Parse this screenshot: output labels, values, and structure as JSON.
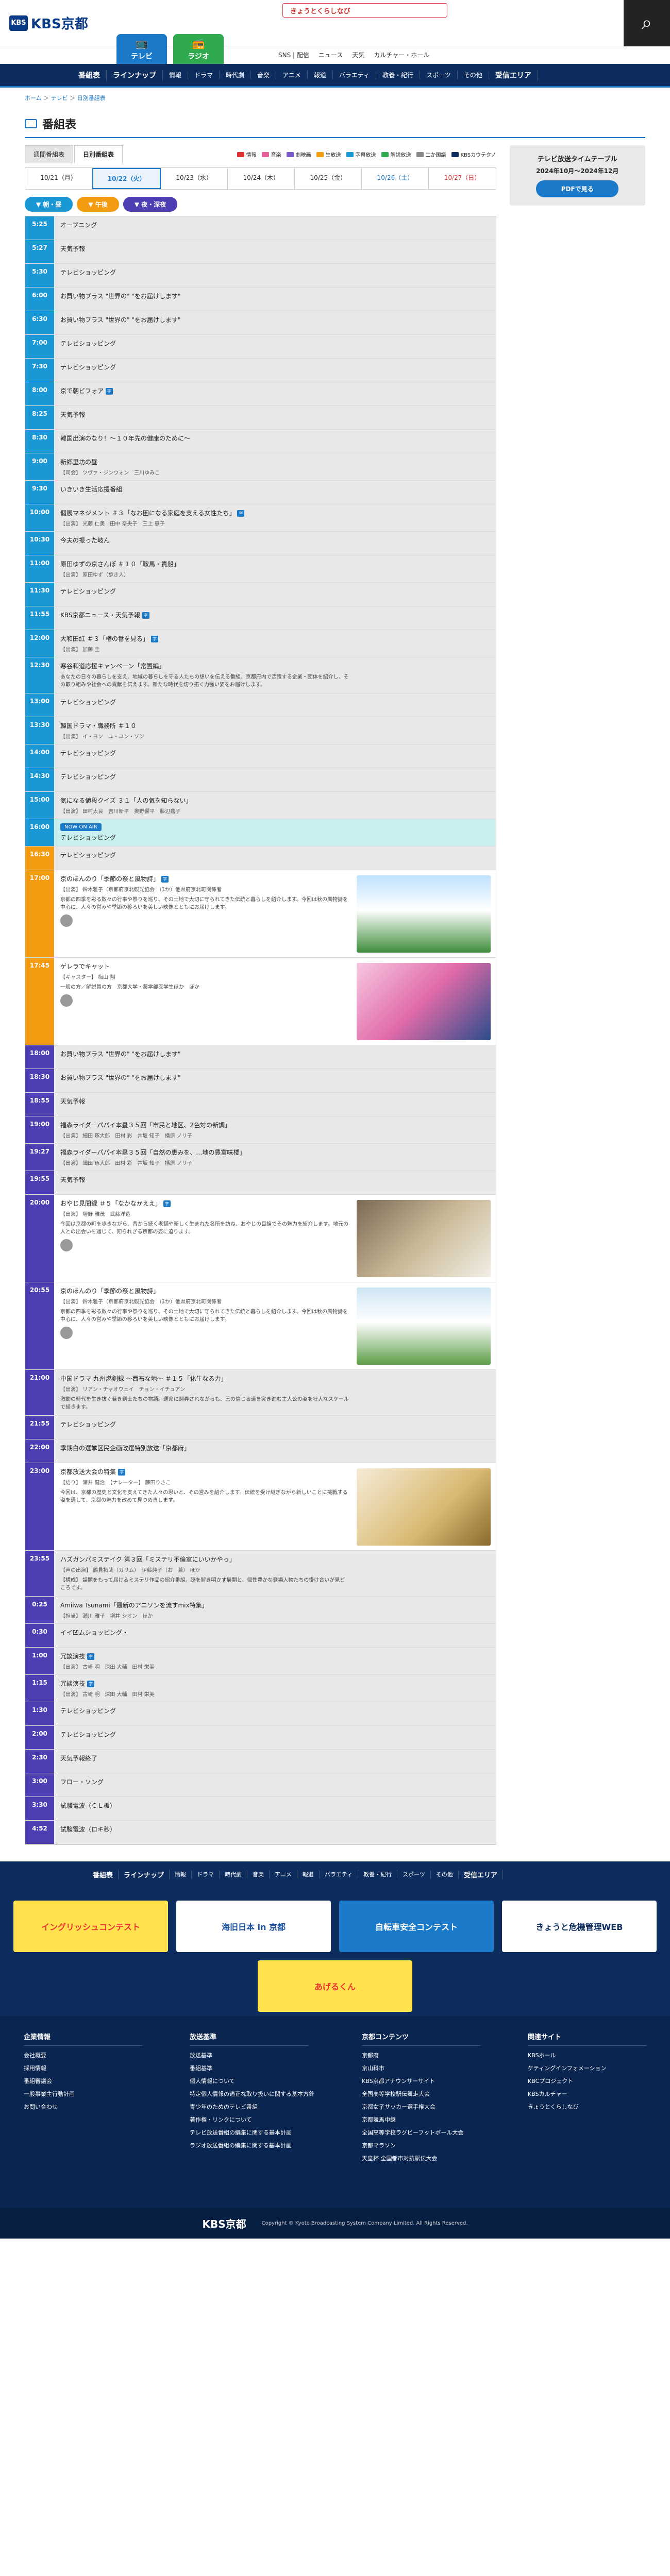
{
  "header": {
    "logo": "KBS京都",
    "logo_mark": "KBS",
    "tv": "テレビ",
    "radio": "ラジオ",
    "ad": "きょうとくらしなび",
    "search_icon": "⌕",
    "util": [
      "SNS | 配信",
      "ニュース",
      "天気",
      "カルチャー・ホール"
    ]
  },
  "gnav": [
    {
      "l": "番組表",
      "s": false
    },
    {
      "l": "ラインナップ",
      "s": false
    },
    {
      "l": "情報",
      "s": true
    },
    {
      "l": "ドラマ",
      "s": true
    },
    {
      "l": "時代劇",
      "s": true
    },
    {
      "l": "音楽",
      "s": true
    },
    {
      "l": "アニメ",
      "s": true
    },
    {
      "l": "報道",
      "s": true
    },
    {
      "l": "バラエティ",
      "s": true
    },
    {
      "l": "教養・紀行",
      "s": true
    },
    {
      "l": "スポーツ",
      "s": true
    },
    {
      "l": "その他",
      "s": true
    },
    {
      "l": "受信エリア",
      "s": false
    }
  ],
  "breadcrumb": {
    "home": "ホーム",
    "tv": "テレビ",
    "current": "日別番組表"
  },
  "page_title": "番組表",
  "view_tabs": [
    "週間番組表",
    "日別番組表"
  ],
  "genres": [
    {
      "c": "#d33",
      "l": "情報"
    },
    {
      "c": "#e45f9c",
      "l": "音楽"
    },
    {
      "c": "#7a5ac8",
      "l": "劇映画"
    },
    {
      "c": "#f39b11",
      "l": "生放送"
    },
    {
      "c": "#1a98d6",
      "l": "字幕放送"
    },
    {
      "c": "#2faa4e",
      "l": "解説放送"
    },
    {
      "c": "#888",
      "l": "二か国語"
    },
    {
      "c": "#0c2d5e",
      "l": "KBSカウテクノ"
    }
  ],
  "days": [
    "10/21（月）",
    "10/22（火）",
    "10/23（水）",
    "10/24（木）",
    "10/25（金）",
    "10/26（土）",
    "10/27（日）"
  ],
  "periods": {
    "am": "▼ 朝・昼",
    "pm": "▼ 午後",
    "night": "▼ 夜・深夜"
  },
  "now_label": "NOW ON AIR",
  "programs": [
    {
      "t": "5:25",
      "c": "a",
      "title": "オープニング"
    },
    {
      "t": "5:27",
      "c": "a",
      "title": "天気予報"
    },
    {
      "t": "5:30",
      "c": "a",
      "title": "テレビショッピング"
    },
    {
      "t": "6:00",
      "c": "a",
      "title": "お買い物プラス \"世界の\" \"をお届けします\""
    },
    {
      "t": "6:30",
      "c": "a",
      "title": "お買い物プラス \"世界の\" \"をお届けします\""
    },
    {
      "t": "7:00",
      "c": "a",
      "title": "テレビショッピング"
    },
    {
      "t": "7:30",
      "c": "a",
      "title": "テレビショッピング"
    },
    {
      "t": "8:00",
      "c": "a",
      "title": "京で朝ビフォア",
      "b": "字"
    },
    {
      "t": "8:25",
      "c": "a",
      "title": "天気予報"
    },
    {
      "t": "8:30",
      "c": "a",
      "title": "韓国出演のなり！〜１０年先の健康のために〜"
    },
    {
      "t": "9:00",
      "c": "a",
      "title": "新郷里坊の昼",
      "cast": "【司会】 ツヴァ・ジンウォン　三川ゆみこ"
    },
    {
      "t": "9:30",
      "c": "a",
      "title": "いきいき生活応援番組"
    },
    {
      "t": "10:00",
      "c": "a",
      "title": "個展マネジメント ＃３「なお困になる家庭を支える女性たち」",
      "b": "字",
      "cast": "【出演】 光藤 仁美　田中 奈央子　三上 恵子"
    },
    {
      "t": "10:30",
      "c": "a",
      "title": "今夫の振った岐ん"
    },
    {
      "t": "11:00",
      "c": "a",
      "title": "原田ゆずの京さんぽ ＃１０「鞍馬・貴船」",
      "cast": "【出演】 原田ゆず（歩き人）"
    },
    {
      "t": "11:30",
      "c": "a",
      "title": "テレビショッピング"
    },
    {
      "t": "11:55",
      "c": "a",
      "title": "KBS京都ニュース・天気予報",
      "b": "字"
    },
    {
      "t": "12:00",
      "c": "a",
      "title": "大和田紅 ＃３「権の番を見る」",
      "b": "字",
      "cast": "【出演】 加藤 圭"
    },
    {
      "t": "12:30",
      "c": "a",
      "title": "寒谷和道応援キャンペーン「常置編」",
      "desc": "あなたの日々の暮らしを支え、地域の暮らしを守る人たちの想いを伝える番組。京都府内で活躍する企業・団体を紹介し、その取り組みや社会への貢献を伝えます。新たな時代を切り拓く力強い姿をお届けします。"
    },
    {
      "t": "13:00",
      "c": "a",
      "title": "テレビショッピング"
    },
    {
      "t": "13:30",
      "c": "a",
      "title": "韓国ドラマ・職務所 ＃１０",
      "cast": "【出演】 イ・ヨン　ユ・ユン・ソン"
    },
    {
      "t": "14:00",
      "c": "a",
      "title": "テレビショッピング"
    },
    {
      "t": "14:30",
      "c": "a",
      "title": "テレビショッピング"
    },
    {
      "t": "15:00",
      "c": "a",
      "title": "気になる値段クイズ ３１「人の気を知らない」",
      "cast": "【出演】 田村太良　吉川新平　奥野響平　藤辺嘉子"
    },
    {
      "t": "16:00",
      "c": "a",
      "title": "テレビショッピング",
      "live": true
    },
    {
      "t": "16:30",
      "c": "b",
      "title": "テレビショッピング"
    },
    {
      "t": "17:00",
      "c": "b",
      "title": "京のほんのり「季節の祭と風物詩」",
      "b": "字",
      "cast": "【出演】 鈴木雅子（京都府京北観光協会　ほか）他県府京北町関係者",
      "desc": "京都の四季を彩る数々の行事や祭りを巡り、その土地で大切に守られてきた伝統と暮らしを紹介します。今回は秋の風物詩を中心に、人々の営みや季節の移ろいを美しい映像とともにお届けします。",
      "thumb": "th1",
      "clip": true,
      "white": true
    },
    {
      "t": "17:45",
      "c": "b",
      "title": "ゲレラでキャット",
      "cast": "【キャスター】 梅山 翔",
      "desc": "一般の方／解説員の方　京都大学・薬学部医学生ほか　ほか",
      "thumb": "th2",
      "clip": true,
      "white": true
    },
    {
      "t": "18:00",
      "c": "c",
      "title": "お買い物プラス \"世界の\" \"をお届けします\""
    },
    {
      "t": "18:30",
      "c": "c",
      "title": "お買い物プラス \"世界の\" \"をお届けします\""
    },
    {
      "t": "18:55",
      "c": "c",
      "title": "天気予報"
    },
    {
      "t": "19:00",
      "c": "c",
      "title": "福森ライダーパパイ本塁３５回「市民と地区、2色対の新調」",
      "cast": "【出演】 細田 琢大郎　田村 彩　井坂 知子　播原 ノリ子"
    },
    {
      "t": "19:27",
      "c": "c",
      "title": "福森ライダーパパイ本塁３５回「自然の恵みを、…地の豊富味楼」",
      "cast": "【出演】 細田 琢大郎　田村 彩　井坂 知子　播原 ノリ子"
    },
    {
      "t": "19:55",
      "c": "c",
      "title": "天気予報"
    },
    {
      "t": "20:00",
      "c": "c",
      "title": "おやじ見聞録 ＃５「なかなかええ」",
      "b": "字",
      "cast": "【出演】 増野 雅茂　武藤洋造",
      "desc": "今回は京都の町を歩きながら、昔から続く老舗や新しく生まれた名所を訪ね、おやじの目線でその魅力を紹介します。地元の人との出会いを通じて、知られざる京都の姿に迫ります。",
      "thumb": "th3",
      "clip": true,
      "white": true
    },
    {
      "t": "20:55",
      "c": "c",
      "title": "京のほんのり「季節の祭と風物詩」",
      "cast": "【出演】 鈴木雅子（京都府京北観光協会　ほか）他県府京北町関係者",
      "desc": "京都の四季を彩る数々の行事や祭りを巡り、その土地で大切に守られてきた伝統と暮らしを紹介します。今回は秋の風物詩を中心に、人々の営みや季節の移ろいを美しい映像とともにお届けします。",
      "thumb": "th4",
      "clip": true,
      "white": true
    },
    {
      "t": "21:00",
      "c": "c",
      "title": "中国ドラマ 九州燃剣録 ～西布な地～ ＃１５「化生なる力」",
      "cast": "【出演】 リアン・チャオウェイ　チョン・イチュアン",
      "desc": "激動の時代を生き抜く若き剣士たちの物語。運命に翻弄されながらも、己の信じる道を突き進む主人公の姿を壮大なスケールで描きます。"
    },
    {
      "t": "21:55",
      "c": "c",
      "title": "テレビショッピング"
    },
    {
      "t": "22:00",
      "c": "c",
      "title": "季期白の選挙区民企画政選特別放送「京都府」"
    },
    {
      "t": "23:00",
      "c": "c",
      "title": "京都放送大会の特集",
      "b": "字",
      "cast": "【語り】 浦井 健治　【ナレーター】 藤田りさこ",
      "desc": "今回は、京都の歴史と文化を支えてきた人々の思いと、その営みを紹介します。伝統を受け継ぎながら新しいことに挑戦する姿を通して、京都の魅力を改めて見つめ直します。",
      "thumb": "th5",
      "white": true
    },
    {
      "t": "23:55",
      "c": "c",
      "title": "ハズガンパミステイク 第３回「ミステリ不倫室にいいかやっ」",
      "cast": "【声の出演】 鶴見拓哉（ガリム）　伊藤純子（お　兼） ほか",
      "desc": "【構成】 話題をもって届けるミステリ作品の紹介番組。謎を解き明かす展開と、個性豊かな登場人物たちの掛け合いが見どころです。"
    },
    {
      "t": "0:25",
      "c": "c",
      "title": "Amiiwa Tsunami「最新のアニソンを流すmix特集」",
      "cast": "【担当】 瀬川 雅子　増井 シオン　ほか"
    },
    {
      "t": "0:30",
      "c": "c",
      "title": "イイ凹ムショッピング・"
    },
    {
      "t": "1:00",
      "c": "c",
      "title": "冗談演技",
      "b": "字",
      "cast": "【出演】 古﨑 明　深田 大輔　田村 栄美"
    },
    {
      "t": "1:15",
      "c": "c",
      "title": "冗談演技",
      "b": "字",
      "cast": "【出演】 古﨑 明　深田 大輔　田村 栄美"
    },
    {
      "t": "1:30",
      "c": "c",
      "title": "テレビショッピング"
    },
    {
      "t": "2:00",
      "c": "c",
      "title": "テレビショッピング"
    },
    {
      "t": "2:30",
      "c": "c",
      "title": "天気予報終了"
    },
    {
      "t": "3:00",
      "c": "c",
      "title": "フロー・ソング"
    },
    {
      "t": "3:30",
      "c": "c",
      "title": "試験電波（ＣＬ板）"
    },
    {
      "t": "4:52",
      "c": "c",
      "title": "試験電波（ロキ秒）"
    }
  ],
  "side": {
    "heading": "テレビ放送タイムテーブル",
    "period": "2024年10月～2024年12月",
    "pdf": "PDFで見る"
  },
  "footer_nav": [
    {
      "l": "番組表",
      "s": false
    },
    {
      "l": "ラインナップ",
      "s": false
    },
    {
      "l": "情報",
      "s": true
    },
    {
      "l": "ドラマ",
      "s": true
    },
    {
      "l": "時代劇",
      "s": true
    },
    {
      "l": "音楽",
      "s": true
    },
    {
      "l": "アニメ",
      "s": true
    },
    {
      "l": "報道",
      "s": true
    },
    {
      "l": "バラエティ",
      "s": true
    },
    {
      "l": "教養・紀行",
      "s": true
    },
    {
      "l": "スポーツ",
      "s": true
    },
    {
      "l": "その他",
      "s": true
    },
    {
      "l": "受信エリア",
      "s": false
    }
  ],
  "banners": [
    {
      "l": "イングリッシュコンテスト",
      "bg": "#ffe24d",
      "fg": "#e33"
    },
    {
      "l": "海旧日本 in 京都",
      "bg": "#ffffff",
      "fg": "#1a4fa0"
    },
    {
      "l": "自転車安全コンテスト",
      "bg": "#1a79c9",
      "fg": "#ffffff"
    },
    {
      "l": "きょうと危機管理WEB",
      "bg": "#ffffff",
      "fg": "#0c2d5e"
    },
    {
      "l": "あげるくん",
      "bg": "#ffe24d",
      "fg": "#e33"
    }
  ],
  "footer_cols": [
    {
      "h": "企業情報",
      "items": [
        "会社概要",
        "採用情報",
        "番組審議会",
        "一般事業主行動計画",
        "お問い合わせ"
      ]
    },
    {
      "h": "放送基準",
      "items": [
        "放送基準",
        "番組基準",
        "個人情報について",
        "特定個人情報の適正な取り扱いに関する基本方針",
        "青少年のためのテレビ番組",
        "著作権・リンクについて",
        "テレビ放送番組の編集に関する基本計画",
        "ラジオ放送番組の編集に関する基本計画"
      ]
    },
    {
      "h": "京都コンテンツ",
      "items": [
        "京都府",
        "京山科市",
        "KBS京都アナウンサーサイト",
        "全国高等学校駅伝競走大会",
        "京都女子サッカー選手権大会",
        "京都競馬中継",
        "全国高等学校ラグビーフットボール大会",
        "京都マラソン",
        "天皇杯 全国都市対抗駅伝大会"
      ]
    },
    {
      "h": "関連サイト",
      "items": [
        "KBSホール",
        "ケティングインフォメーション",
        "KBCプロジェクト",
        "KBSカルチャー",
        "きょうとくらしなび"
      ]
    }
  ],
  "footer_bottom": {
    "logo": "KBS京都",
    "copy": "Copyright © Kyoto Broadcasting System Company Limited. All Rights Reserved."
  }
}
